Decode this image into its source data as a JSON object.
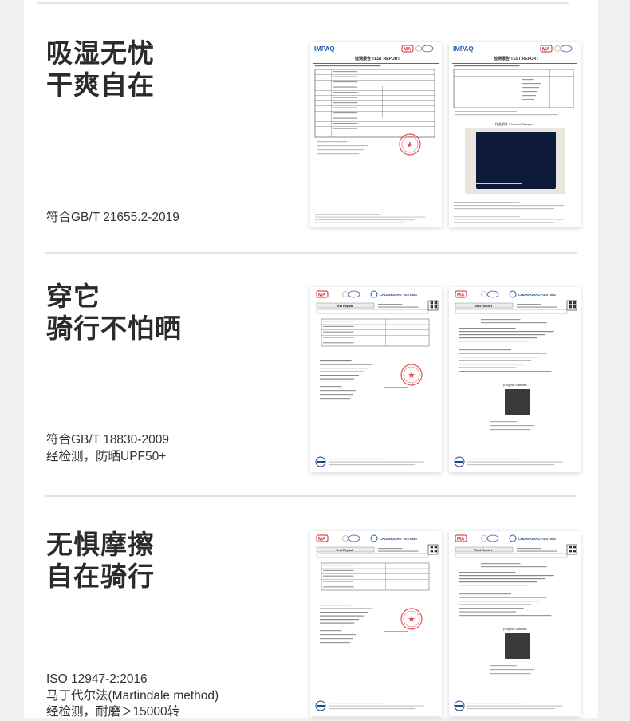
{
  "sections": [
    {
      "headline": [
        "吸湿无忧",
        "干爽自在"
      ],
      "notes": [
        "符合GB/T 21655.2-2019"
      ],
      "docs": [
        {
          "brand": "IMPAQ",
          "title": "检测报告 TEST REPORT",
          "kind": "table"
        },
        {
          "brand": "IMPAQ",
          "title": "检测报告 TEST REPORT",
          "kind": "photo",
          "caption": "样品照片 Photo of Sample"
        }
      ]
    },
    {
      "headline": [
        "穿它",
        "骑行不怕晒"
      ],
      "notes": [
        "符合GB/T 18830-2009",
        "经检测，防晒UPF50+"
      ],
      "docs": [
        {
          "brand": "CHUANGHAO TESTING",
          "title": "Test Report",
          "kind": "cert"
        },
        {
          "brand": "CHUANGHAO TESTING",
          "title": "Test Report",
          "kind": "cert-photo"
        }
      ]
    },
    {
      "headline": [
        "无惧摩擦",
        "自在骑行"
      ],
      "notes": [
        "ISO 12947-2:2016",
        "马丁代尔法(Martindale method)",
        "经检测，耐磨＞15000转"
      ],
      "docs": [
        {
          "brand": "CHUANGHAO TESTING",
          "title": "Test Report",
          "kind": "cert"
        },
        {
          "brand": "CHUANGHAO TESTING",
          "title": "Test Report",
          "kind": "cert-photo"
        }
      ]
    }
  ],
  "colors": {
    "impaq_blue": "#1f5aa8",
    "ma_red": "#d8242a",
    "fabric_navy": "#0d1a3a",
    "stamp_red": "#d9383e"
  }
}
